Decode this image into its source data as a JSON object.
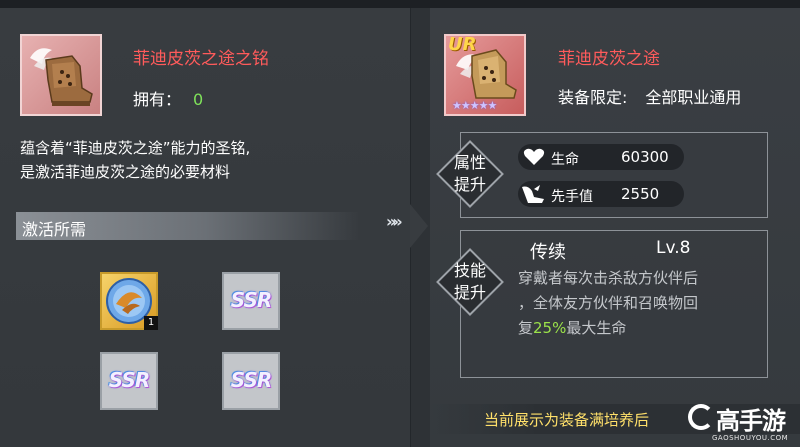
{
  "left": {
    "item_title": "菲迪皮茨之途之铭",
    "owned_label": "拥有：",
    "owned_count": "0",
    "description_line1": "蕴含着“菲迪皮茨之途”能力的圣铭,",
    "description_line2": "是激活菲迪皮茨之途的必要材料",
    "requirement_header": "激活所需",
    "materials": [
      {
        "label": "",
        "count": "1"
      },
      {
        "label": "SSR"
      },
      {
        "label": "SSR"
      },
      {
        "label": "SSR"
      }
    ]
  },
  "arrows": "»»",
  "right": {
    "rarity_badge": "UR",
    "stars": "★★★★★",
    "item_title": "菲迪皮茨之途",
    "equip_label": "装备限定:",
    "equip_value": "全部职业通用",
    "attr_section_line1": "属性",
    "attr_section_line2": "提升",
    "stats": [
      {
        "name": "生命",
        "value": "60300",
        "icon": "heart-icon"
      },
      {
        "name": "先手值",
        "value": "2550",
        "icon": "winged-boot-icon"
      }
    ],
    "skill_section_line1": "技能",
    "skill_section_line2": "提升",
    "skill_name": "传续",
    "skill_level": "Lv.8",
    "skill_desc_line1": "穿戴者每次击杀敌方伙伴后",
    "skill_desc_line2": "，全体友方伙伴和召唤物回",
    "skill_desc_line3_pre": "复",
    "skill_desc_highlight": "25%",
    "skill_desc_line3_post": "最大生命"
  },
  "footer": {
    "notice": "当前展示为装备满培养后"
  },
  "watermark": {
    "name": "高手游",
    "url": "GAOSHOUYOU.COM"
  },
  "colors": {
    "title_red": "#ff5b5b",
    "owned_green": "#7fe25a",
    "highlight_green": "#9be24a",
    "footer_yellow": "#ffe06a"
  }
}
